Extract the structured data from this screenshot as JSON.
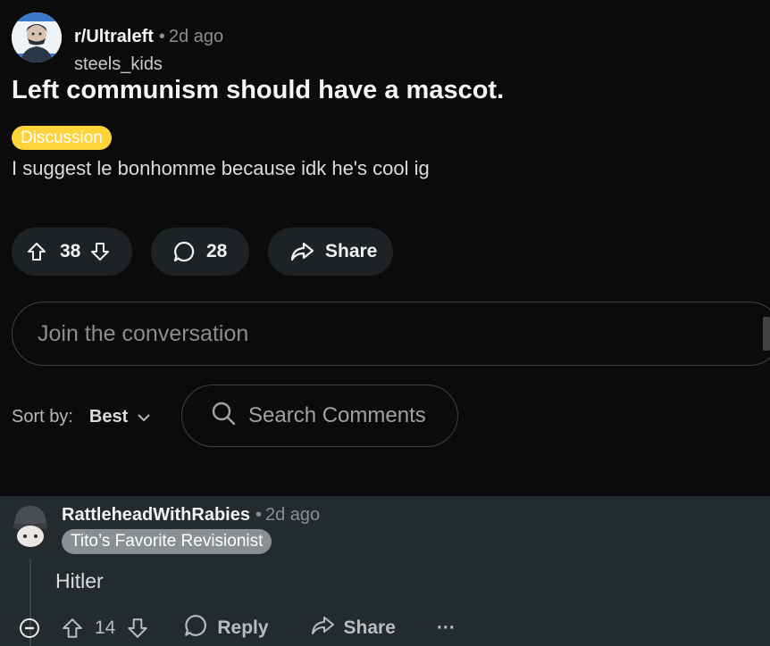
{
  "post": {
    "subreddit": "r/Ultraleft",
    "separator": "•",
    "time": "2d ago",
    "author": "steels_kids",
    "title": "Left communism should have a mascot.",
    "flair": "Discussion",
    "body": "I suggest le bonhomme because idk he's cool ig",
    "votes": "38",
    "comments": "28",
    "share_label": "Share"
  },
  "join": {
    "placeholder": "Join the conversation"
  },
  "sort": {
    "label": "Sort by:",
    "value": "Best"
  },
  "search": {
    "placeholder": "Search Comments"
  },
  "comment": {
    "author": "RattleheadWithRabies",
    "separator": "•",
    "time": "2d ago",
    "flair": "Tito’s Favorite Revisionist",
    "body": "Hitler",
    "votes": "14",
    "reply_label": "Reply",
    "share_label": "Share",
    "more_label": "···"
  },
  "colors": {
    "background": "#0b0b0b",
    "pill": "#1f2224",
    "flair_discussion": "#ffd33a",
    "comment_bg": "#242b2f",
    "user_flair": "#8a8f92"
  },
  "icons": [
    "subreddit-avatar-icon",
    "upvote-icon",
    "downvote-icon",
    "comment-icon",
    "share-icon",
    "chevron-down-icon",
    "search-icon",
    "collapse-icon",
    "reply-icon",
    "more-icon"
  ]
}
